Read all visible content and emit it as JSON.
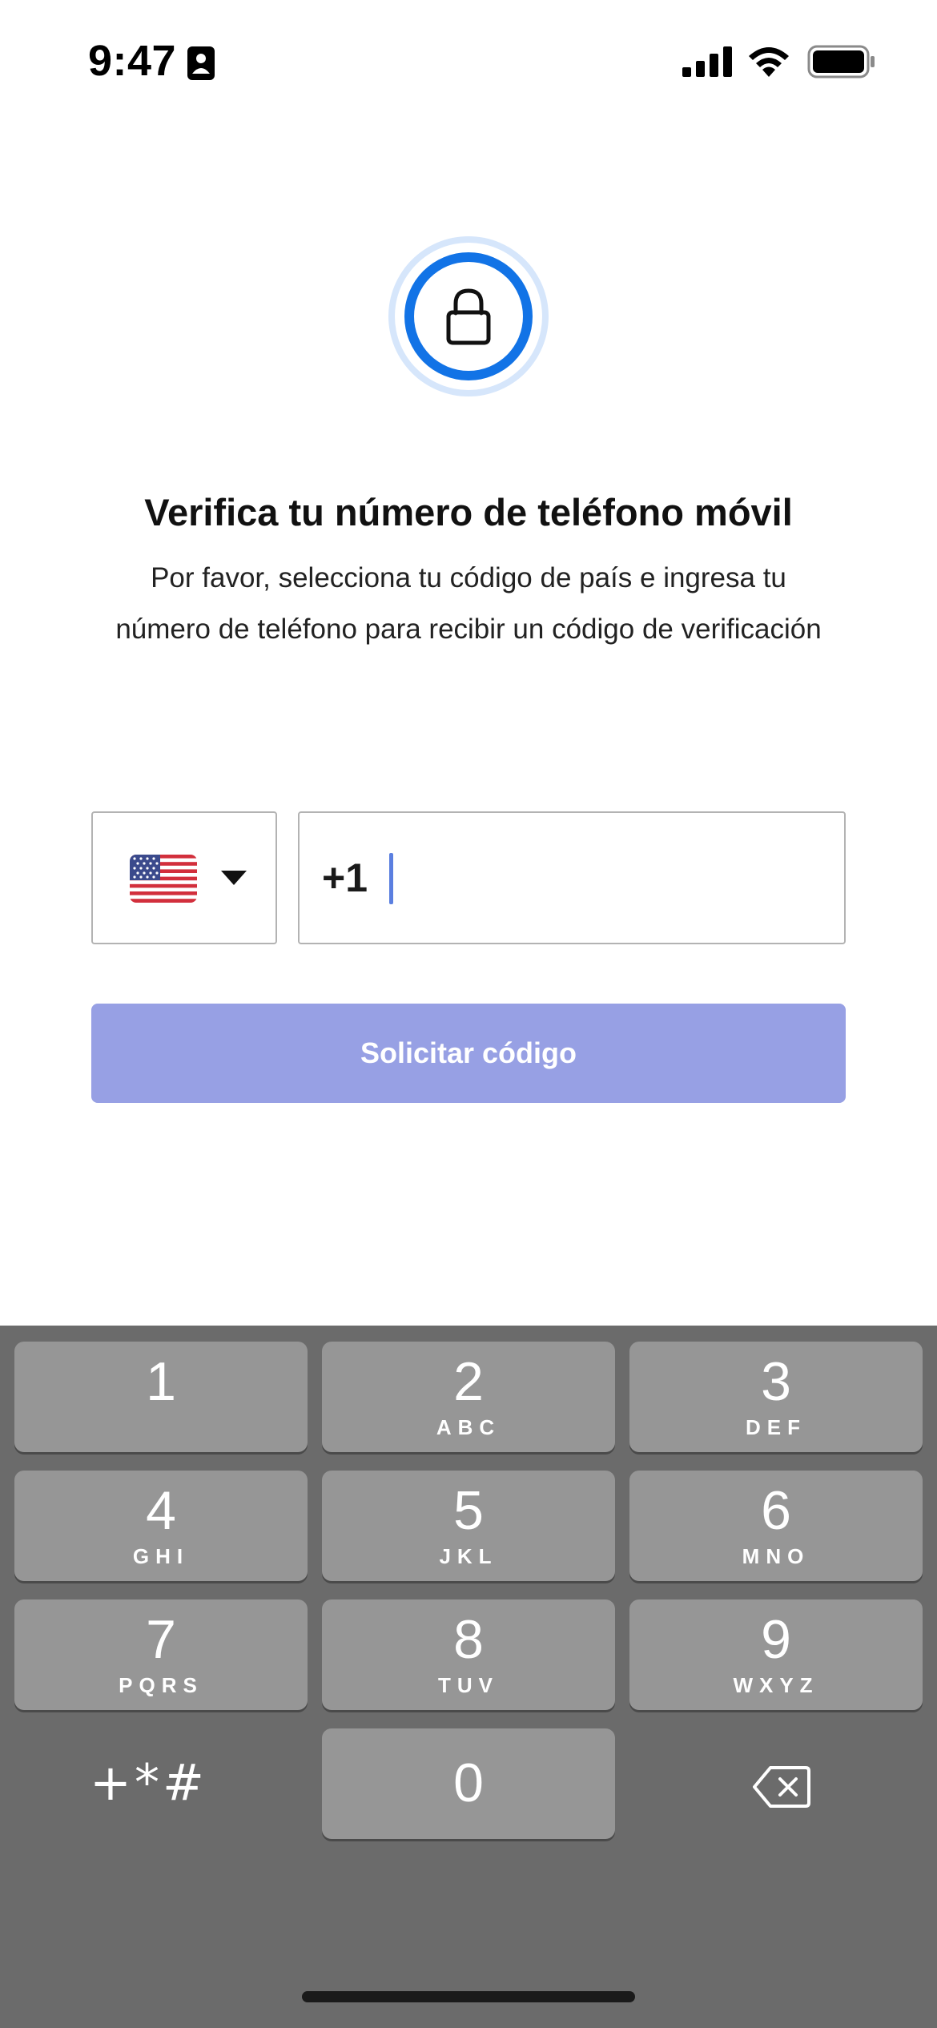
{
  "status_bar": {
    "time": "9:47",
    "icons": [
      "contact-card-icon",
      "cellular-signal-icon",
      "wifi-icon",
      "battery-icon"
    ]
  },
  "header": {
    "icon": "lock-icon",
    "title": "Verifica tu número de teléfono móvil",
    "subtitle": "Por favor, selecciona tu código de país e ingresa tu número de teléfono para recibir un código de verificación"
  },
  "phone_form": {
    "country": {
      "flag": "us-flag-icon",
      "selected": "US"
    },
    "dial_code": "+1",
    "phone_value": "",
    "submit_label": "Solicitar código"
  },
  "colors": {
    "accent": "#1273e6",
    "accent_ring": "#d6e6fb",
    "button_disabled": "#97a0e4",
    "keyboard_bg": "#6b6b6b",
    "key_bg": "#969696"
  },
  "keyboard": {
    "keys": [
      {
        "digit": "1",
        "letters": ""
      },
      {
        "digit": "2",
        "letters": "ABC"
      },
      {
        "digit": "3",
        "letters": "DEF"
      },
      {
        "digit": "4",
        "letters": "GHI"
      },
      {
        "digit": "5",
        "letters": "JKL"
      },
      {
        "digit": "6",
        "letters": "MNO"
      },
      {
        "digit": "7",
        "letters": "PQRS"
      },
      {
        "digit": "8",
        "letters": "TUV"
      },
      {
        "digit": "9",
        "letters": "WXYZ"
      },
      {
        "digit": "0",
        "letters": ""
      }
    ],
    "symbols_label": "+*#",
    "delete_icon": "backspace-icon"
  }
}
